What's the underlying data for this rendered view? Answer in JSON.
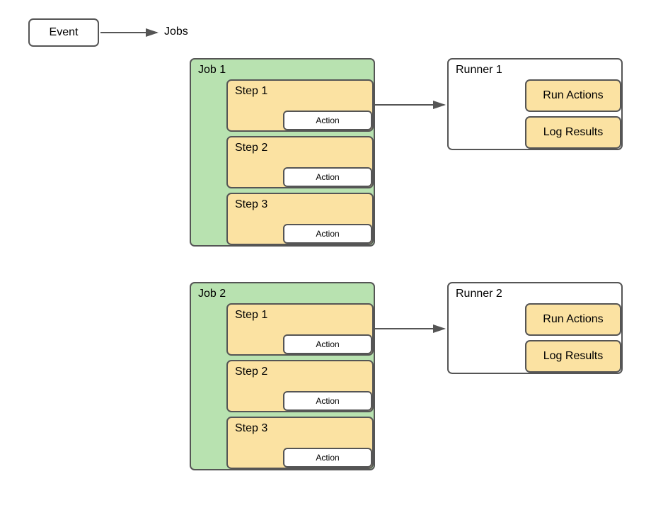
{
  "event": {
    "label": "Event"
  },
  "jobs_heading": "Jobs",
  "jobs": [
    {
      "title": "Job 1",
      "steps": [
        {
          "title": "Step 1",
          "action": "Action"
        },
        {
          "title": "Step 2",
          "action": "Action"
        },
        {
          "title": "Step 3",
          "action": "Action"
        }
      ]
    },
    {
      "title": "Job 2",
      "steps": [
        {
          "title": "Step 1",
          "action": "Action"
        },
        {
          "title": "Step 2",
          "action": "Action"
        },
        {
          "title": "Step 3",
          "action": "Action"
        }
      ]
    }
  ],
  "runners": [
    {
      "title": "Runner 1",
      "items": [
        "Run Actions",
        "Log Results"
      ]
    },
    {
      "title": "Runner 2",
      "items": [
        "Run Actions",
        "Log Results"
      ]
    }
  ],
  "colors": {
    "job_fill": "#b8e2b0",
    "step_fill": "#fbe2a2",
    "border": "#555555"
  }
}
